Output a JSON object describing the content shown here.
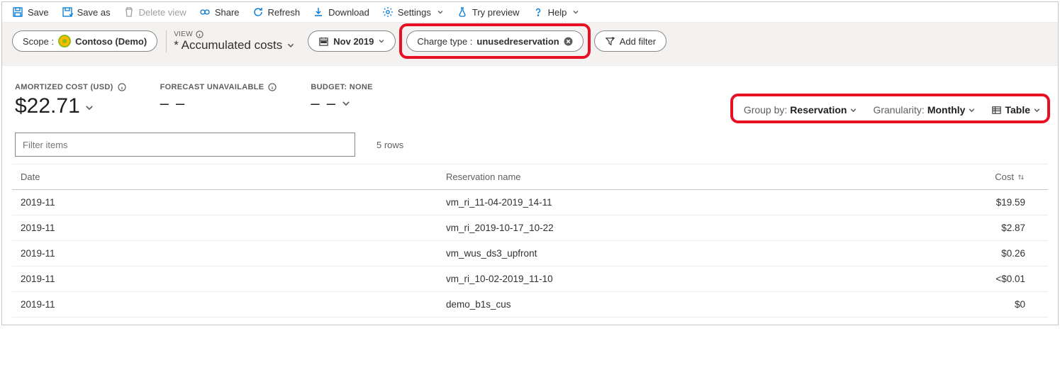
{
  "toolbar": {
    "save": "Save",
    "save_as": "Save as",
    "delete_view": "Delete view",
    "share": "Share",
    "refresh": "Refresh",
    "download": "Download",
    "settings": "Settings",
    "try_preview": "Try preview",
    "help": "Help"
  },
  "filterbar": {
    "scope_label": "Scope :",
    "scope_value": "Contoso (Demo)",
    "view_label": "VIEW",
    "view_name": "* Accumulated costs",
    "date": "Nov 2019",
    "charge_type_label": "Charge type :",
    "charge_type_value": "unusedreservation",
    "add_filter": "Add filter"
  },
  "metrics": {
    "amortized_label": "AMORTIZED COST (USD)",
    "amortized_value": "$22.71",
    "forecast_label": "FORECAST UNAVAILABLE",
    "forecast_value": "– –",
    "budget_label": "BUDGET: NONE",
    "budget_value": "– –"
  },
  "controls": {
    "group_by_label": "Group by:",
    "group_by_value": "Reservation",
    "granularity_label": "Granularity:",
    "granularity_value": "Monthly",
    "view_mode": "Table"
  },
  "filter": {
    "placeholder": "Filter items",
    "rowcount": "5 rows"
  },
  "table": {
    "headers": {
      "date": "Date",
      "reservation": "Reservation name",
      "cost": "Cost"
    },
    "rows": [
      {
        "date": "2019-11",
        "reservation": "vm_ri_11-04-2019_14-11",
        "cost": "$19.59"
      },
      {
        "date": "2019-11",
        "reservation": "vm_ri_2019-10-17_10-22",
        "cost": "$2.87"
      },
      {
        "date": "2019-11",
        "reservation": "vm_wus_ds3_upfront",
        "cost": "$0.26"
      },
      {
        "date": "2019-11",
        "reservation": "vm_ri_10-02-2019_11-10",
        "cost": "<$0.01"
      },
      {
        "date": "2019-11",
        "reservation": "demo_b1s_cus",
        "cost": "$0"
      }
    ]
  }
}
